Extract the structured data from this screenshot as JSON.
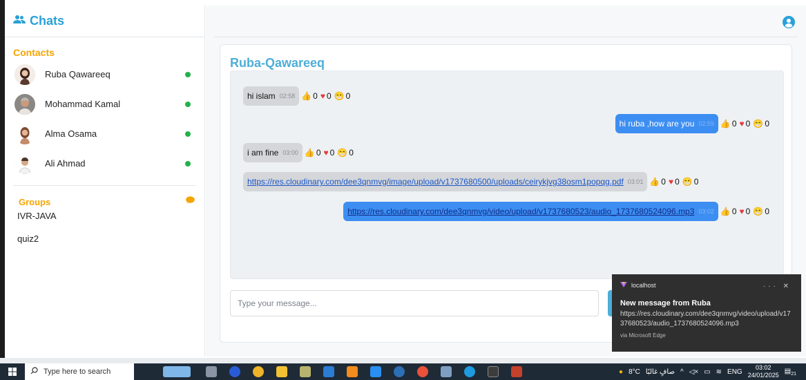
{
  "sidebar": {
    "title": "Chats",
    "contacts_heading": "Contacts",
    "contacts": [
      {
        "name": "Ruba Qawareeq",
        "avatar": "woman-avatar"
      },
      {
        "name": "Mohammad Kamal",
        "avatar": "man-avatar"
      },
      {
        "name": "Alma Osama",
        "avatar": "woman-avatar"
      },
      {
        "name": "Ali Ahmad",
        "avatar": "man-avatar"
      }
    ],
    "groups_heading": "Groups",
    "groups": [
      "IVR-JAVA",
      "quiz2"
    ]
  },
  "chat": {
    "title": "Ruba-Qawareeq",
    "messages": [
      {
        "side": "recv",
        "text": "hi islam",
        "time": "02:58",
        "like": "0",
        "love": "0",
        "laugh": "0"
      },
      {
        "side": "sent",
        "text": "hi ruba ,how are you",
        "time": "02:59",
        "like": "0",
        "love": "0",
        "laugh": "0"
      },
      {
        "side": "recv",
        "text": "i am fine",
        "time": "03:00",
        "like": "0",
        "love": "0",
        "laugh": "0"
      },
      {
        "side": "recv",
        "text": "https://res.cloudinary.com/dee3qnmvg/image/upload/v1737680500/uploads/ceirykjvg38osm1popqg.pdf",
        "time": "03:01",
        "like": "0",
        "love": "0",
        "laugh": "0"
      },
      {
        "side": "sent",
        "text": "https://res.cloudinary.com/dee3qnmvg/video/upload/v1737680523/audio_1737680524096.mp3",
        "time": "03:02",
        "like": "0",
        "love": "0",
        "laugh": "0"
      }
    ],
    "input_placeholder": "Type your message..."
  },
  "notification": {
    "app": "localhost",
    "actions": "···  ✕",
    "title": "New message from Ruba",
    "body": "https://res.cloudinary.com/dee3qnmvg/video/upload/v1737680523/audio_1737680524096.mp3",
    "via": "via Microsoft Edge"
  },
  "taskbar": {
    "search_placeholder": "Type here to search",
    "weather": "8°C",
    "weather_text": "صافٍ غالبًا",
    "language": "ENG",
    "time": "03:02",
    "date": "24/01/2025",
    "notification_count": "21"
  },
  "colors": {
    "accent": "#29a0d8",
    "contacts_heading": "#f5a400",
    "sent_bubble": "#3d8ef2",
    "recv_bubble": "#d4d6d9",
    "online": "#22b24c"
  }
}
